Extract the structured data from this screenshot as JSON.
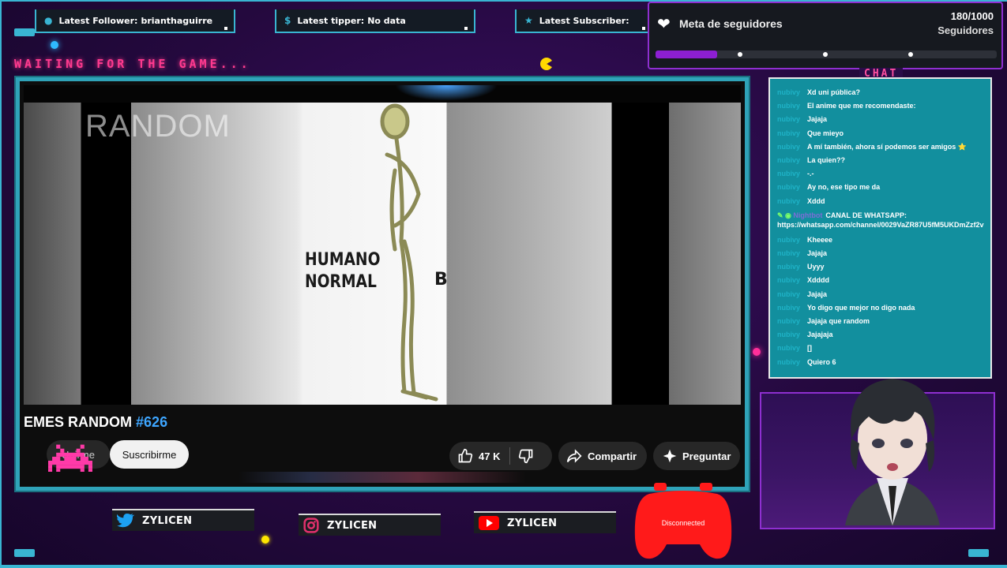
{
  "alerts": {
    "follower": {
      "label": "Latest Follower:",
      "value": "brianthaguirre",
      "icon": "user-icon"
    },
    "tipper": {
      "label": "Latest tipper:",
      "value": "No data",
      "icon": "dollar-icon"
    },
    "subscriber": {
      "label": "Latest Subscriber:",
      "value": "",
      "icon": "star-icon"
    }
  },
  "goal": {
    "title": "Meta de seguidores",
    "count": "180/1000",
    "unit": "Seguidores",
    "progress": 0.18,
    "color": "#8d1fd2"
  },
  "waiting_text": "WAITING FOR THE GAME...",
  "video": {
    "watermark": "RANDOM",
    "caption_line1": "HUMANO",
    "caption_line2": "NORMAL",
    "caption_partial": "B",
    "title_prefix": "EMES RANDOM",
    "title_number": "#626",
    "join_label": "Unirme",
    "subscribe_label": "Suscribirme",
    "likes": "47 K",
    "share_label": "Compartir",
    "ask_label": "Preguntar"
  },
  "chat": {
    "title": "CHAT",
    "messages": [
      {
        "user": "nubivy",
        "text": "Xd uni pública?"
      },
      {
        "user": "nubivy",
        "text": "El anime que me recomendaste:"
      },
      {
        "user": "nubivy",
        "text": "Jajaja"
      },
      {
        "user": "nubivy",
        "text": "Que mieyo"
      },
      {
        "user": "nubivy",
        "text": "A mí también, ahora sí podemos ser amigos ⭐"
      },
      {
        "user": "nubivy",
        "text": "La quien??"
      },
      {
        "user": "nubivy",
        "text": "-.-"
      },
      {
        "user": "nubivy",
        "text": "Ay no, ese tipo me da"
      },
      {
        "user": "nubivy",
        "text": "Xddd"
      },
      {
        "user": "Nightbot",
        "text": "CANAL DE WHATSAPP: https://whatsapp.com/channel/0029VaZR87U5fM5UKDmZzf2v",
        "wide": true
      },
      {
        "user": "nubivy",
        "text": "Kheeee"
      },
      {
        "user": "nubivy",
        "text": "Jajaja"
      },
      {
        "user": "nubivy",
        "text": "Uyyy"
      },
      {
        "user": "nubivy",
        "text": "Xdddd"
      },
      {
        "user": "nubivy",
        "text": "Jajaja"
      },
      {
        "user": "nubivy",
        "text": "Yo digo que mejor no digo nada"
      },
      {
        "user": "nubivy",
        "text": "Jajaja que random"
      },
      {
        "user": "nubivy",
        "text": "Jajajaja"
      },
      {
        "user": "nubivy",
        "text": "[]"
      },
      {
        "user": "nubivy",
        "text": "Quiero 6"
      }
    ]
  },
  "socials": {
    "twitter": {
      "handle": "ZYLICEN",
      "icon": "twitter-icon",
      "color": "#1da1f2"
    },
    "instagram": {
      "handle": "ZYLICEN",
      "icon": "instagram-icon",
      "color": "#e1306c"
    },
    "youtube": {
      "handle": "ZYLICEN",
      "icon": "youtube-icon",
      "color": "#ff0000"
    }
  },
  "controller": {
    "status": "Disconnected",
    "color": "#ff1a1a"
  },
  "colors": {
    "frame": "#39b5d2",
    "accent_pink": "#ff3a8f",
    "chat_bg": "#128f9e",
    "purple": "#8e2fd0"
  }
}
